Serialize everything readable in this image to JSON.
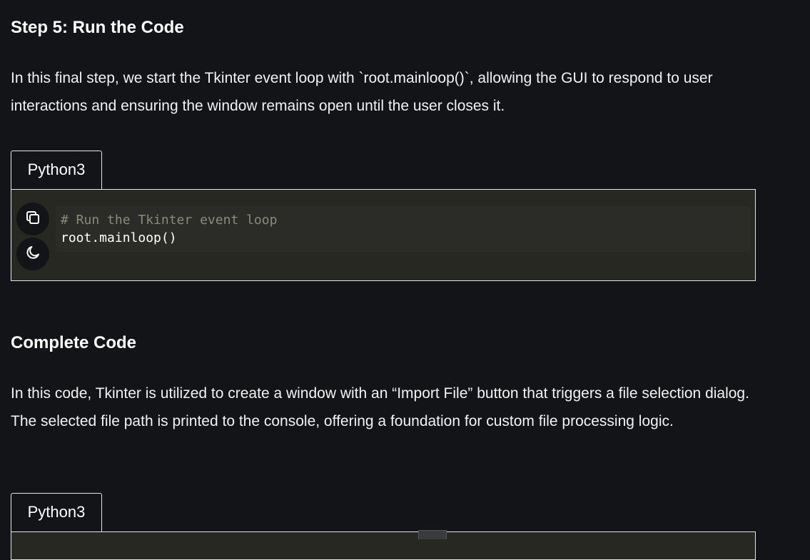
{
  "step5": {
    "heading": "Step 5: Run the Code",
    "paragraph": "In this final step, we start the Tkinter event loop with `root.mainloop()`, allowing the GUI to respond to user interactions and ensuring the window remains open until the user closes it.",
    "language_tab": "Python3",
    "code": {
      "comment": "# Run the Tkinter event loop",
      "line": "root.mainloop()"
    }
  },
  "complete": {
    "heading": "Complete Code",
    "paragraph": "In this code, Tkinter is utilized to create a window with an “Import File” button that triggers a file selection dialog. The selected file path is printed to the console, offering a foundation for custom file processing logic.",
    "language_tab": "Python3"
  },
  "icons": {
    "copy": "copy-icon",
    "theme": "moon-icon"
  },
  "colors": {
    "page_bg": "#131417",
    "code_bg": "#272822",
    "comment": "#8a8a7a"
  }
}
